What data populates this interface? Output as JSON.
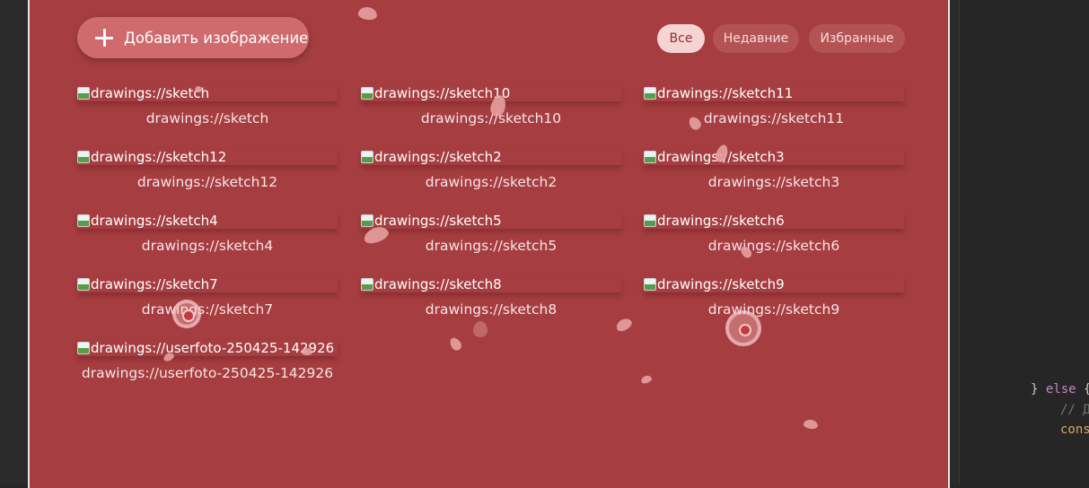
{
  "toolbar": {
    "add_label": "Добавить изображение"
  },
  "filters": [
    "Все",
    "Недавние",
    "Избранные"
  ],
  "active_filter": "Все",
  "gallery": [
    {
      "alt": "drawings://sketch",
      "caption": "drawings://sketch"
    },
    {
      "alt": "drawings://sketch10",
      "caption": "drawings://sketch10"
    },
    {
      "alt": "drawings://sketch11",
      "caption": "drawings://sketch11"
    },
    {
      "alt": "drawings://sketch12",
      "caption": "drawings://sketch12"
    },
    {
      "alt": "drawings://sketch2",
      "caption": "drawings://sketch2"
    },
    {
      "alt": "drawings://sketch3",
      "caption": "drawings://sketch3"
    },
    {
      "alt": "drawings://sketch4",
      "caption": "drawings://sketch4"
    },
    {
      "alt": "drawings://sketch5",
      "caption": "drawings://sketch5"
    },
    {
      "alt": "drawings://sketch6",
      "caption": "drawings://sketch6"
    },
    {
      "alt": "drawings://sketch7",
      "caption": "drawings://sketch7"
    },
    {
      "alt": "drawings://sketch8",
      "caption": "drawings://sketch8"
    },
    {
      "alt": "drawings://sketch9",
      "caption": "drawings://sketch9"
    },
    {
      "alt": "drawings://userfoto-250425-142926",
      "caption": "drawings://userfoto-250425-142926"
    }
  ],
  "editor": {
    "line1_brace": "} ",
    "line1_kw": "else",
    "line1_tail": " {",
    "line2": "// Д",
    "line3": "cons"
  },
  "colors": {
    "panel": "#a63e41",
    "accent_button": "#cf6b6d",
    "active_chip": "#f6d4d4",
    "petal": "#e9a6a6"
  }
}
